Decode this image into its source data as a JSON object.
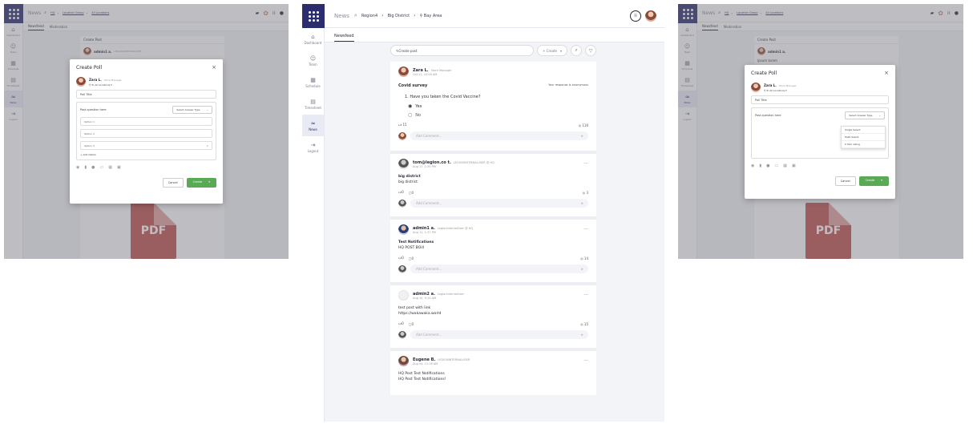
{
  "left_panel": {
    "app_title": "News",
    "breadcrumb": [
      "HQ",
      "Location Group",
      "All Locations"
    ],
    "tabs": [
      "Newsfeed",
      "Moderation"
    ],
    "rail": [
      "Dashboard",
      "Team",
      "Schedule",
      "Timesheet",
      "News",
      "Logout"
    ],
    "create_post": "Create Post",
    "bg_post_author": "admin1 a.",
    "bg_post_role": "LEGIONINTERNALUSER",
    "pdf_label": "PDF",
    "modal": {
      "title": "Create Poll",
      "close": "×",
      "user_name": "Zara L.",
      "user_role": "Store Manager",
      "location": "To All Locations",
      "poll_title_placeholder": "Poll Title",
      "question_placeholder": "Post question here",
      "answer_type": "Select Answer Type",
      "options": [
        "Option 1",
        "Option 2",
        "Option 3"
      ],
      "add_option": "+ Add Option",
      "cancel": "Cancel",
      "create": "Create"
    }
  },
  "center_panel": {
    "app_title": "News",
    "breadcrumb": [
      "Region4",
      "Big District",
      "Bay Area"
    ],
    "tab": "Newsfeed",
    "rail": [
      "Dashboard",
      "Team",
      "Schedule",
      "Timesheet",
      "News",
      "Logout"
    ],
    "create_post_placeholder": "Create post",
    "create_button": "+ Create",
    "comment_placeholder": "Add Comment...",
    "posts": [
      {
        "author": "Zara L.",
        "role": "Store Manager",
        "date": "Oct 21, 10:00 AM",
        "survey_title": "Covid survey",
        "anonymous_note": "Your response is anonymous",
        "question": "1. Have you taken the Covid Vaccine?",
        "answers": [
          "Yes",
          "No"
        ],
        "likes": "15",
        "views": "116"
      },
      {
        "author": "tom@legion.co t.",
        "role": "LEGIONINTERNALUSER @ HQ",
        "date": "Aug 17, 1:35 PM",
        "body": [
          "big district",
          "big district"
        ],
        "likes": "0",
        "comments": "0",
        "views": "3"
      },
      {
        "author": "admin1 a.",
        "role": "LegionInternalUser @ HQ",
        "date": "Aug 11, 1:37 PM",
        "body": [
          "Test Notifications",
          "HQ POST BOill"
        ],
        "likes": "0",
        "comments": "0",
        "views": "14"
      },
      {
        "author": "admin2 a.",
        "role": "LegionInternalUser",
        "date": "Aug 10, 9:10 AM",
        "body": [
          "test post with link",
          "https://wakawaka.world"
        ],
        "likes": "0",
        "comments": "0",
        "views": "15"
      },
      {
        "author": "Eugene B.",
        "role": "LEGIONINTERNALUSER",
        "date": "Aug 04, 11:16 AM",
        "body": [
          "HQ Post Test Notifications",
          "HQ Post Test Notifications!"
        ]
      }
    ]
  },
  "right_panel": {
    "app_title": "News",
    "breadcrumb": [
      "HQ",
      "Location Group",
      "All Locations"
    ],
    "tabs": [
      "Newsfeed",
      "Moderation"
    ],
    "rail": [
      "Dashboard",
      "Team",
      "Schedule",
      "Timesheet",
      "News",
      "Logout"
    ],
    "create_post": "Create Post",
    "bg_post_author": "admin1 a.",
    "bg_post_body": "lpsum lorem",
    "pdf_label": "PDF",
    "modal": {
      "title": "Create Poll",
      "close": "×",
      "user_name": "Zara L.",
      "user_role": "Store Manager",
      "location": "To All Locations",
      "poll_title_placeholder": "Poll Title",
      "question_placeholder": "Post question here",
      "answer_type": "Select Answer Type",
      "answer_types": [
        "Single Select",
        "Multi Select",
        "5 Star rating"
      ],
      "cancel": "Cancel",
      "create": "Create"
    }
  }
}
